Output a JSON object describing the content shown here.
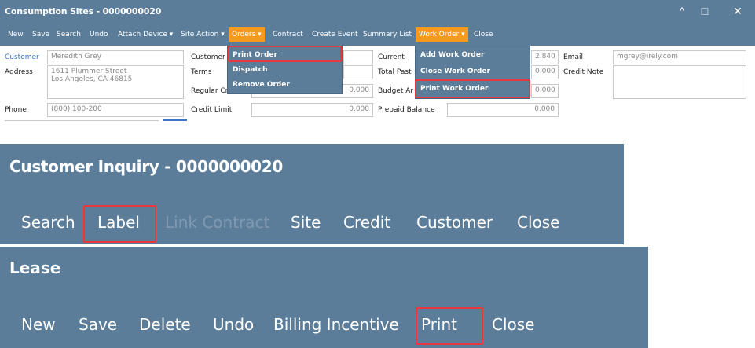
{
  "consumption": {
    "title": "Consumption Sites - 0000000020",
    "window_controls": [
      "^",
      "□",
      "✕"
    ],
    "toolbar": [
      "New",
      "Save",
      "Search",
      "Undo",
      "Attach Device ▾",
      "Site Action ▾",
      "Orders ▾",
      "Contract",
      "Create Event",
      "Summary List",
      "Work Order ▾",
      "Close"
    ],
    "orders_menu": [
      "Print Order",
      "Dispatch",
      "Remove Order"
    ],
    "work_order_menu": [
      "Add Work Order",
      "Close Work Order",
      "Print Work Order"
    ],
    "form": {
      "customer_label": "Customer",
      "customer_value": "Meredith Grey",
      "address_label": "Address",
      "address_line1": "1611 Plummer Street",
      "address_line2": "Los Angeles, CA 46815",
      "phone_label": "Phone",
      "phone_value": "(800) 100-200",
      "customer_no_label": "Customer",
      "terms_label": "Terms",
      "regular_label": "Regular Cr",
      "regular_value": "0.000",
      "credit_limit_label": "Credit Limit",
      "credit_limit_value": "0.000",
      "current_label": "Current",
      "current_value": "2.840",
      "total_past_label": "Total Past",
      "total_past_value": "0.000",
      "budget_label": "Budget Ar",
      "budget_value": "0.000",
      "prepaid_label": "Prepaid Balance",
      "prepaid_value": "0.000",
      "email_label": "Email",
      "email_value": "mgrey@irely.com",
      "credit_note_label": "Credit Note"
    }
  },
  "inquiry": {
    "title": "Customer Inquiry - 0000000020",
    "toolbar": [
      "Search",
      "Label",
      "Link Contract",
      "Site",
      "Credit",
      "Customer",
      "Close"
    ]
  },
  "lease": {
    "title": "Lease",
    "toolbar": [
      "New",
      "Save",
      "Delete",
      "Undo",
      "Billing Incentive",
      "Print",
      "Close"
    ]
  },
  "colors": {
    "header": "#5b7d99",
    "accent": "#f79a1e",
    "highlight": "#e8383d"
  }
}
